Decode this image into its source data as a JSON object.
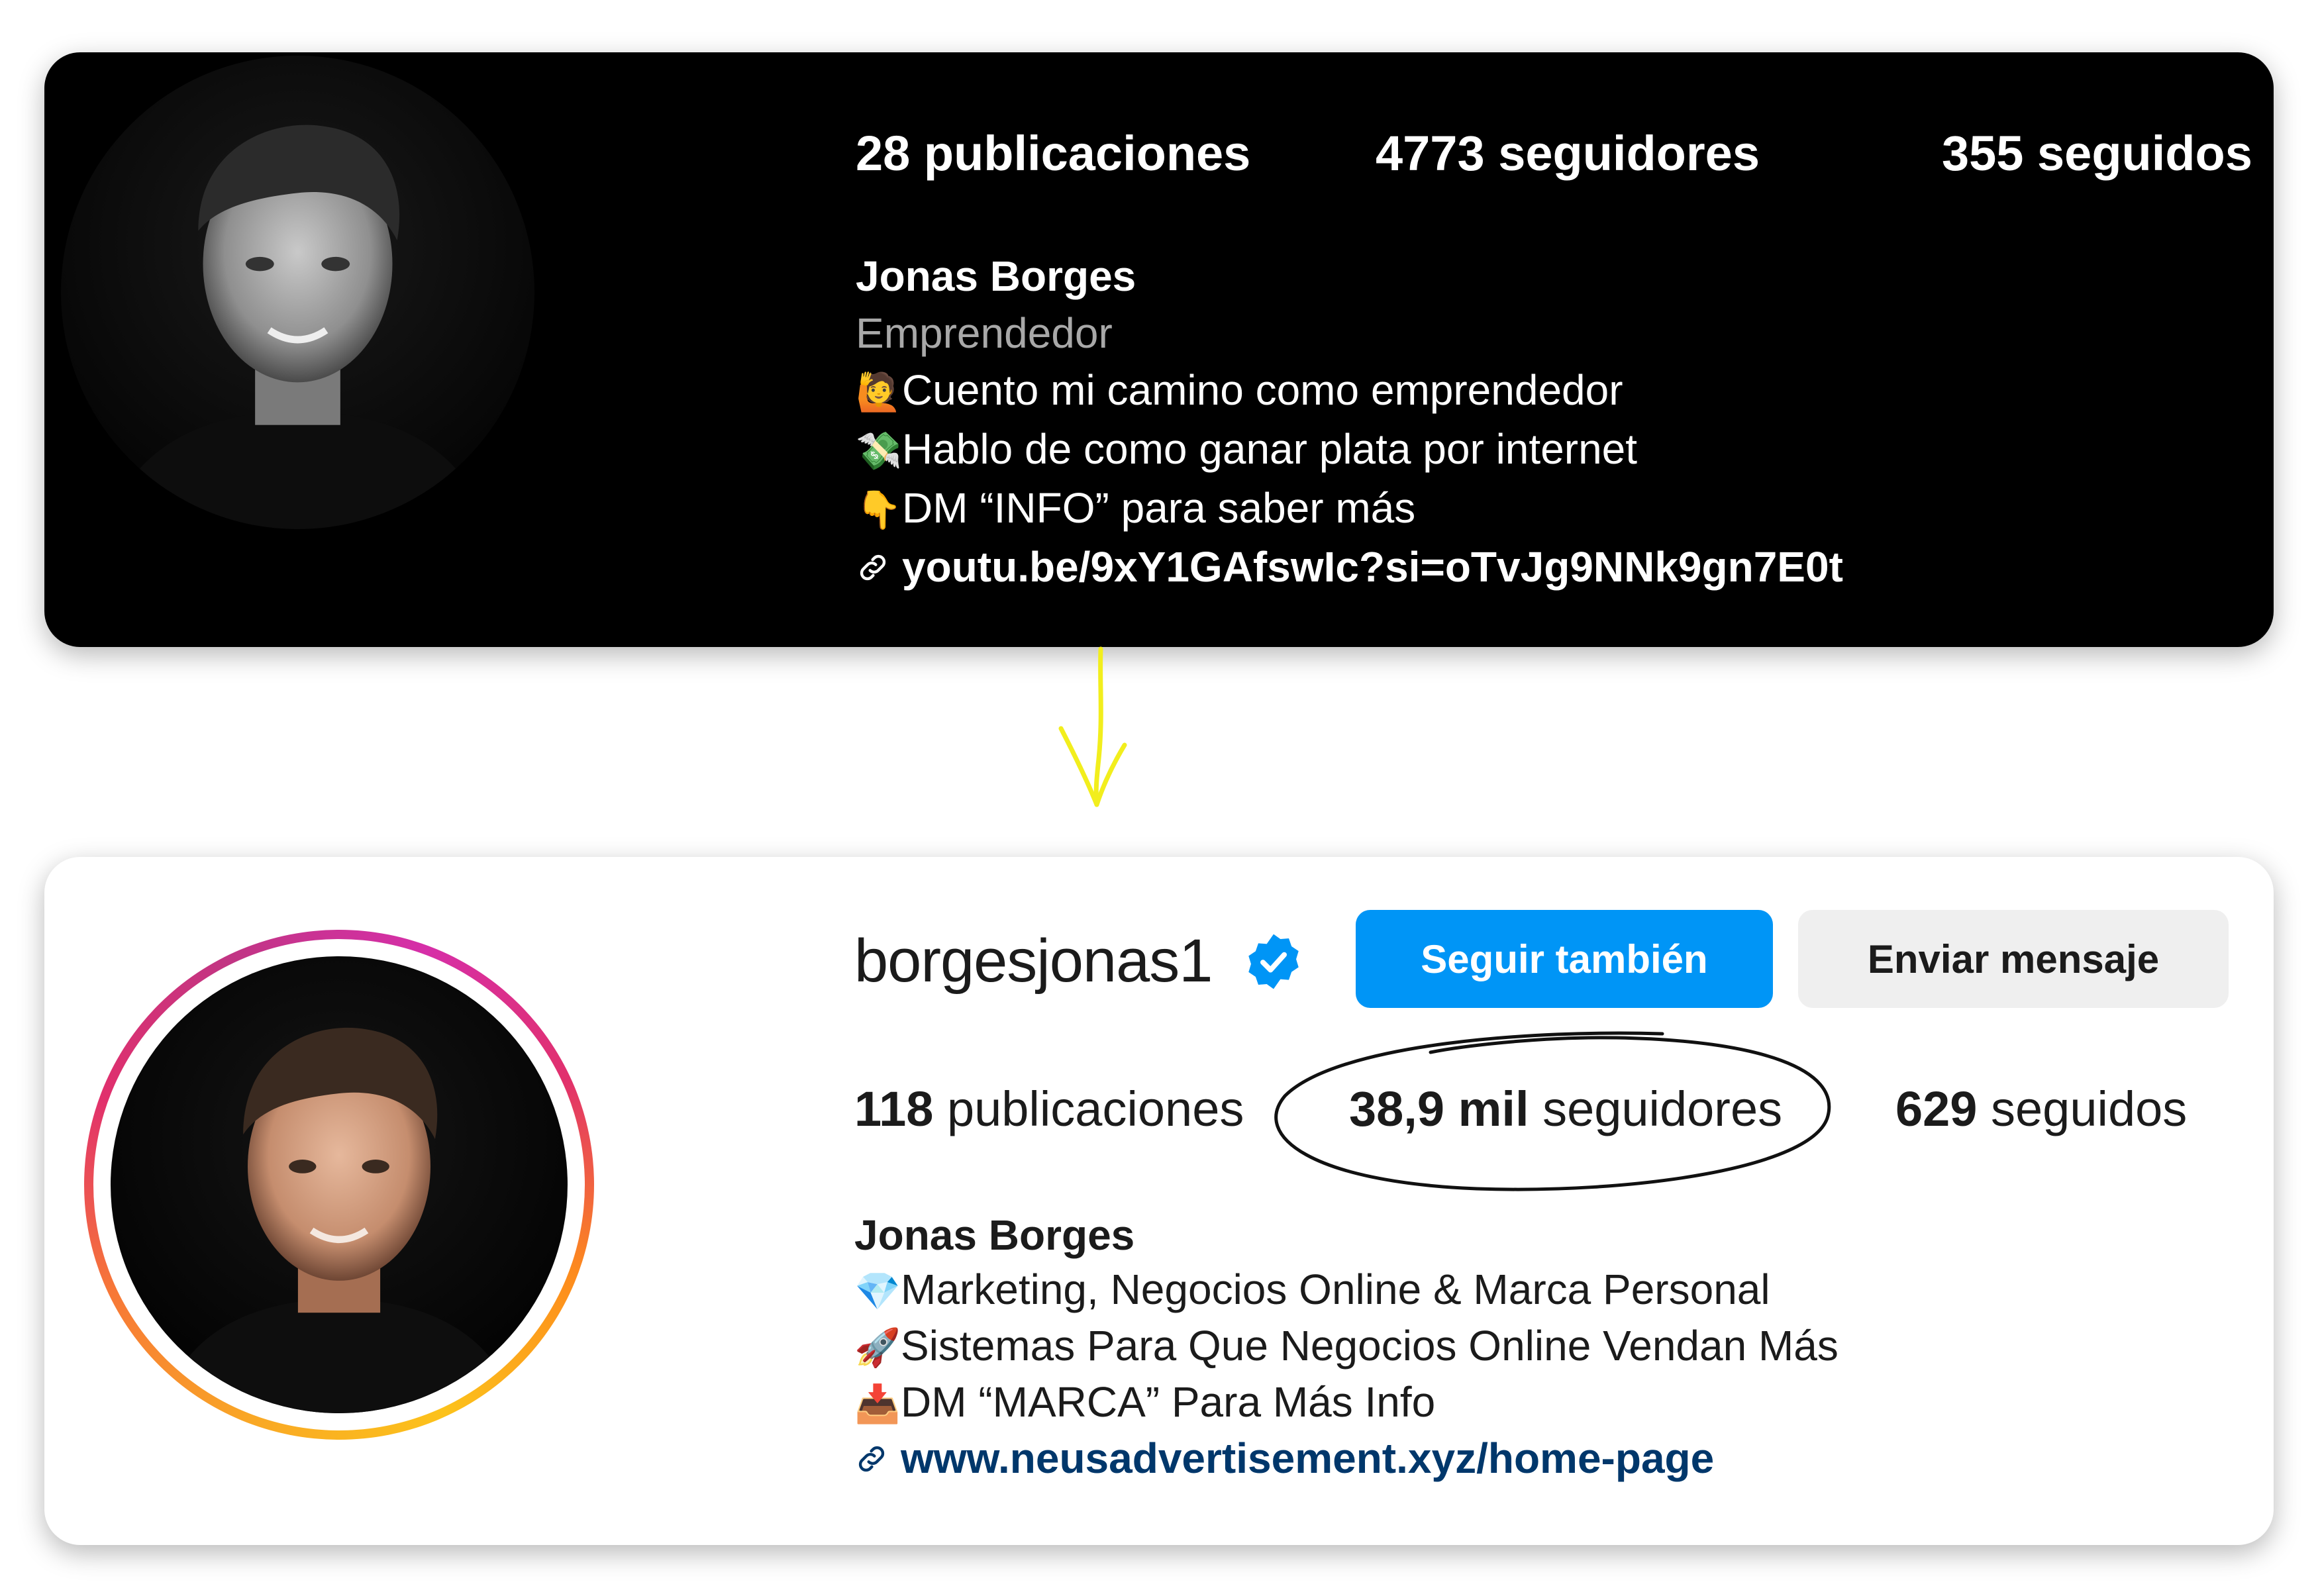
{
  "before": {
    "stats": {
      "posts_count": "28",
      "posts_label": "publicaciones",
      "followers_count": "4773",
      "followers_label": "seguidores",
      "following_count": "355",
      "following_label": "seguidos"
    },
    "name": "Jonas Borges",
    "category": "Emprendedor",
    "bio": [
      {
        "icon": "🙋",
        "text": "Cuento mi camino como emprendedor"
      },
      {
        "icon": "💸",
        "text": "Hablo de como ganar plata por internet"
      },
      {
        "icon": "👇",
        "text": "DM “INFO” para saber más"
      }
    ],
    "link": "youtu.be/9xY1GAfswIc?si=oTvJg9NNk9gn7E0t"
  },
  "after": {
    "username": "borgesjonas1",
    "follow_button": "Seguir también",
    "message_button": "Enviar mensaje",
    "stats": {
      "posts_count": "118",
      "posts_label": "publicaciones",
      "followers_count": "38,9 mil",
      "followers_label": "seguidores",
      "following_count": "629",
      "following_label": "seguidos"
    },
    "name": "Jonas Borges",
    "bio": [
      {
        "icon": "💎",
        "text": "Marketing, Negocios Online & Marca Personal"
      },
      {
        "icon": "🚀",
        "text": "Sistemas Para Que Negocios Online Vendan Más"
      },
      {
        "icon": "📥",
        "text": "DM “MARCA” Para Más Info"
      }
    ],
    "link": "www.neusadvertisement.xyz/home-page"
  },
  "colors": {
    "follow_button": "#0095f6",
    "message_button": "#efefef",
    "verified_badge": "#0095f6",
    "link_light": "#00376b",
    "annotation_arrow": "#f2ee1d",
    "category_gray": "#a8a8a8"
  }
}
